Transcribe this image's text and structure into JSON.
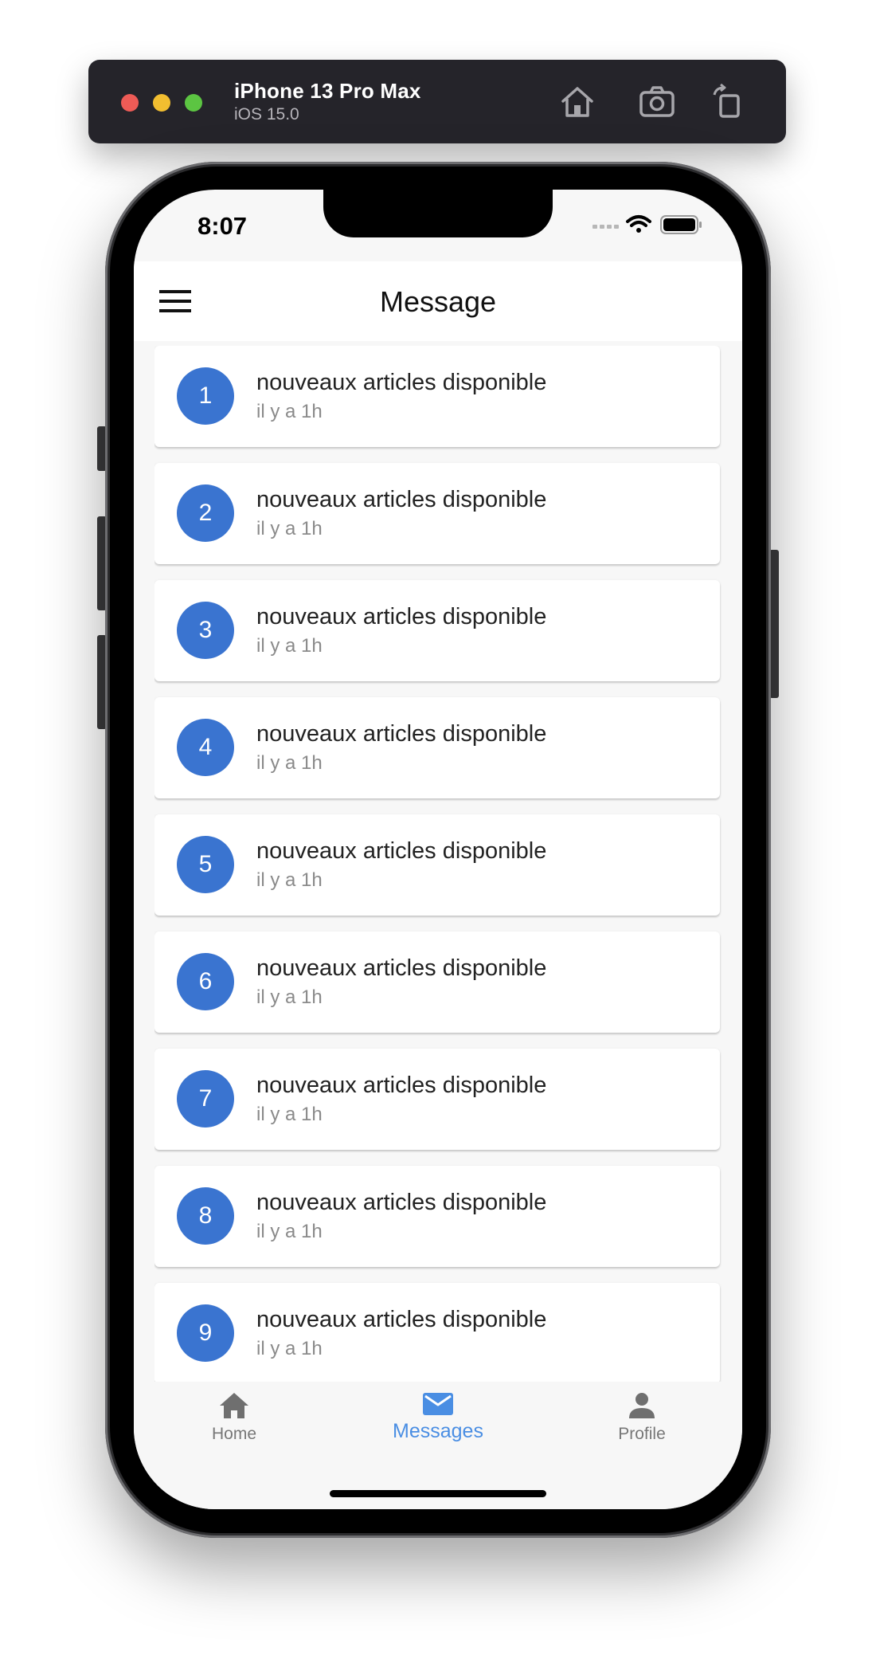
{
  "simulator": {
    "device_name": "iPhone 13 Pro Max",
    "os_version": "iOS 15.0",
    "icons": [
      "home-icon",
      "screenshot-icon",
      "rotate-icon"
    ]
  },
  "status_bar": {
    "time": "8:07",
    "icons": [
      "signal-icon",
      "wifi-icon",
      "battery-icon"
    ]
  },
  "app_bar": {
    "title": "Message",
    "menu_icon": "hamburger-menu-icon"
  },
  "messages": [
    {
      "number": "1",
      "title": "nouveaux articles disponible",
      "time": "il y a 1h"
    },
    {
      "number": "2",
      "title": "nouveaux articles disponible",
      "time": "il y a 1h"
    },
    {
      "number": "3",
      "title": "nouveaux articles disponible",
      "time": "il y a 1h"
    },
    {
      "number": "4",
      "title": "nouveaux articles disponible",
      "time": "il y a 1h"
    },
    {
      "number": "5",
      "title": "nouveaux articles disponible",
      "time": "il y a 1h"
    },
    {
      "number": "6",
      "title": "nouveaux articles disponible",
      "time": "il y a 1h"
    },
    {
      "number": "7",
      "title": "nouveaux articles disponible",
      "time": "il y a 1h"
    },
    {
      "number": "8",
      "title": "nouveaux articles disponible",
      "time": "il y a 1h"
    },
    {
      "number": "9",
      "title": "nouveaux articles disponible",
      "time": "il y a 1h"
    }
  ],
  "bottom_nav": {
    "items": [
      {
        "label": "Home",
        "icon": "home-icon",
        "active": false
      },
      {
        "label": "Messages",
        "icon": "mail-icon",
        "active": true
      },
      {
        "label": "Profile",
        "icon": "person-icon",
        "active": false
      }
    ]
  },
  "colors": {
    "accent": "#3a74d0",
    "active_nav": "#4a8ee3",
    "toolbar": "#25242a",
    "background": "#f7f7f7"
  }
}
